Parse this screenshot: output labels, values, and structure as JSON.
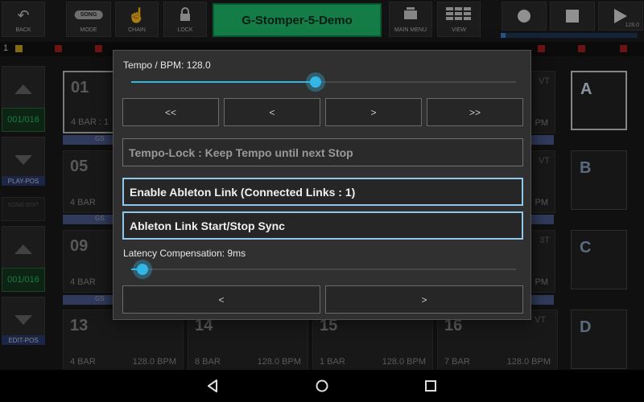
{
  "topbar": {
    "back_label": "BACK",
    "mode_chip": "SONG",
    "mode_label": "MODE",
    "chain_label": "CHAIN",
    "lock_label": "LOCK",
    "song_title": "G-Stomper-5-Demo",
    "main_menu_label": "MAIN MENU",
    "view_label": "VIEW",
    "tempo_readout": "128.0"
  },
  "indicator_row": {
    "track_number": "1"
  },
  "side": {
    "play_counter": "001/016",
    "play_pos_label": "PLAY-POS",
    "song_edit_label": "SONG EDIT",
    "edit_counter": "001/016",
    "edit_pos_label": "EDIT-POS"
  },
  "patterns": [
    {
      "num": "01",
      "bars": "4 BAR : 1",
      "bpm": ""
    },
    {
      "num": "05",
      "bars": "4 BAR",
      "bpm": ""
    },
    {
      "num": "09",
      "bars": "4 BAR",
      "bpm": ""
    },
    {
      "num": "13",
      "bars": "4 BAR",
      "bpm": "128.0 BPM"
    },
    {
      "num": "14",
      "bars": "8 BAR",
      "bpm": "128.0 BPM"
    },
    {
      "num": "15",
      "bars": "1 BAR",
      "bpm": "128.0 BPM"
    },
    {
      "num": "16",
      "bars": "7 BAR",
      "bpm": "128.0 BPM"
    }
  ],
  "right_fragments": [
    "VT",
    "PM",
    "VT",
    "PM",
    "3T",
    "PM",
    "VT"
  ],
  "strip_label": "GS",
  "abc": [
    "A",
    "B",
    "C",
    "D"
  ],
  "dialog": {
    "tempo_label": "Tempo / BPM: 128.0",
    "tempo_value": 128.0,
    "tempo_slider_fraction": 0.48,
    "step_buttons": [
      "<<",
      "<",
      ">",
      ">>"
    ],
    "tempo_lock": "Tempo-Lock : Keep Tempo until next Stop",
    "ableton_link": "Enable Ableton Link (Connected Links : 1)",
    "ableton_sync": "Ableton Link Start/Stop Sync",
    "latency_label": "Latency Compensation: 9ms",
    "latency_slider_fraction": 0.03,
    "latency_buttons": [
      "<",
      ">"
    ]
  },
  "colors": {
    "accent": "#33b5e5",
    "title_green": "#1fbf6e",
    "counter_green": "#22c065",
    "active_border": "#8fc7ec"
  }
}
